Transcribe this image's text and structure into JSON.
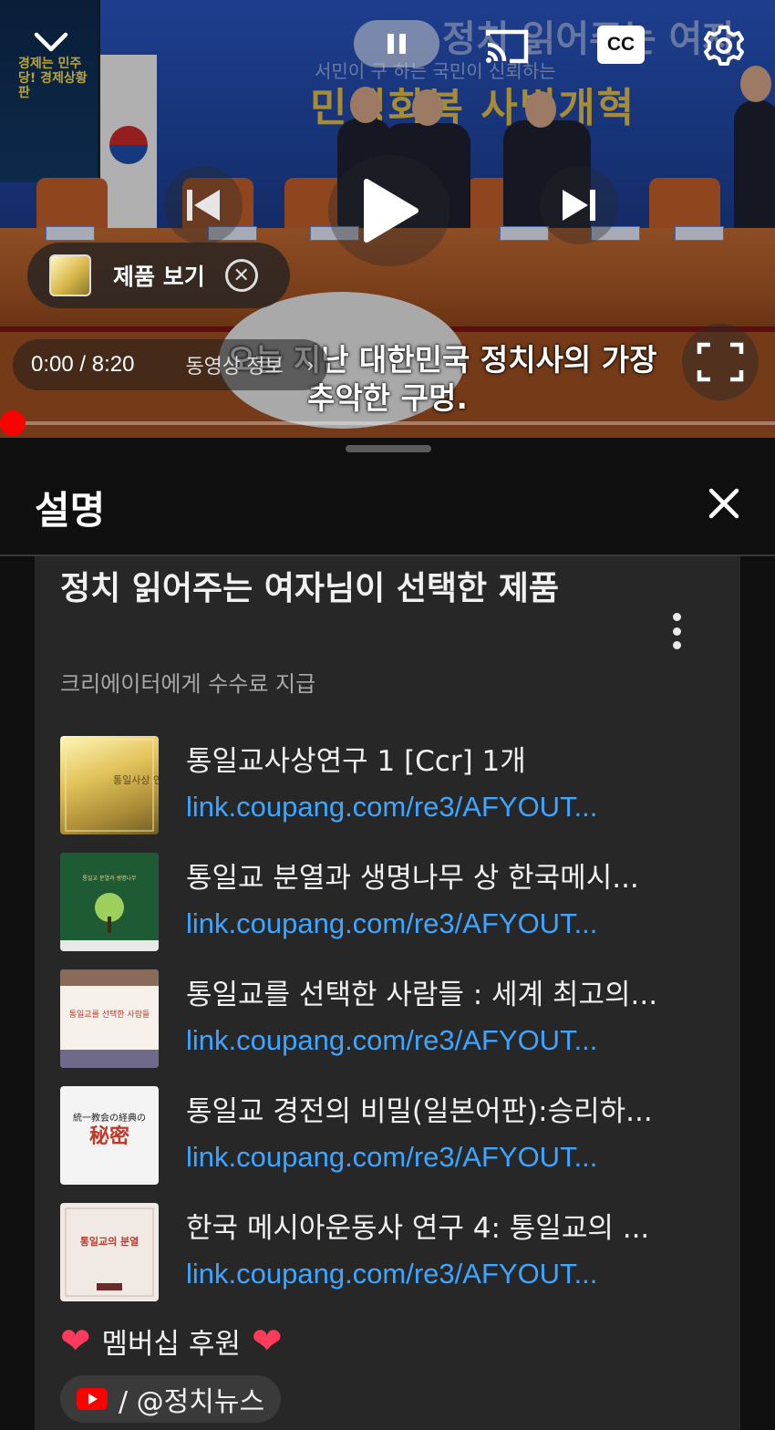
{
  "player": {
    "time_display": "0:00 / 8:20",
    "video_info_label": "동영상 정보",
    "product_chip_label": "제품 보기",
    "cc_label": "CC",
    "subtitle_lines": [
      "오늘 지난 대한민국 정치사의 가장",
      "추악한 구멍."
    ],
    "scene_text": {
      "banner_top": "정치 읽어주는 여자",
      "banner_sub": "서민이 구 하는 국민이 신뢰하는",
      "banner_main": "민생회복 사법개혁",
      "screen_text": "경제는 민주당! 경제상황판"
    },
    "progress": 0.0,
    "icons": {
      "collapse": "chevron-down-icon",
      "pause": "pause-icon",
      "cast": "cast-icon",
      "settings": "gear-icon",
      "previous": "skip-previous-icon",
      "play": "play-icon",
      "next": "skip-next-icon",
      "fullscreen": "fullscreen-icon",
      "close_chip": "close-circle-icon"
    }
  },
  "sheet": {
    "title": "설명",
    "panel": {
      "title": "정치 읽어주는 여자님이 선택한 제품",
      "subtitle": "크리에이터에게 수수료 지급",
      "items": [
        {
          "name": "통일교사상연구 1 [Ccr] 1개",
          "link": "link.coupang.com/re3/AFYOUT..."
        },
        {
          "name": "통일교 분열과 생명나무 상 한국메시...",
          "link": "link.coupang.com/re3/AFYOUT..."
        },
        {
          "name": "통일교를 선택한 사람들 : 세계 최고의...",
          "link": "link.coupang.com/re3/AFYOUT..."
        },
        {
          "name": "통일교 경전의 비밀(일본어판):승리하...",
          "link": "link.coupang.com/re3/AFYOUT..."
        },
        {
          "name": "한국 메시아운동사 연구 4: 통일교의 ...",
          "link": "link.coupang.com/re3/AFYOUT..."
        }
      ],
      "thumb_text": {
        "t1": "통일사상 연구",
        "t2": "통일교 분열과 생명나무",
        "t3": "통일교를 선택한 사람들",
        "t4_title": "統一教会の経典の",
        "t4_big": "秘密",
        "t5": "통일교의 분열"
      }
    },
    "membership_text": "멤버십 후원",
    "channel_handle": "/ @정치뉴스"
  },
  "colors": {
    "accent_red": "#ff0000",
    "link_blue": "#3ea6ff",
    "heart": "#ff3b5c",
    "sheet_bg": "#0f0f0f",
    "panel_bg": "#272727"
  }
}
